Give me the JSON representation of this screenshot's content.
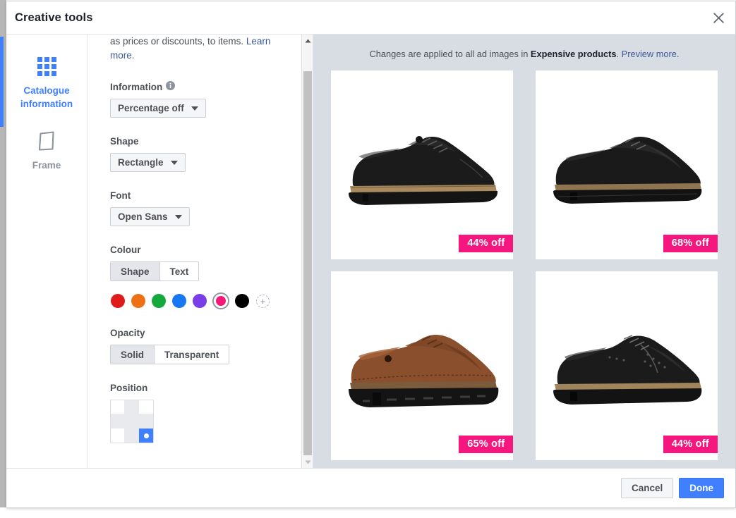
{
  "modal": {
    "title": "Creative tools",
    "close_icon": "close-icon"
  },
  "sidebar": {
    "items": [
      {
        "label": "Catalogue information",
        "icon": "grid-icon",
        "active": true
      },
      {
        "label": "Frame",
        "icon": "frame-icon",
        "active": false
      }
    ]
  },
  "form": {
    "intro_text_1": "as prices or discounts, to items. ",
    "intro_link": "Learn more",
    "intro_text_2": ".",
    "information": {
      "label": "Information",
      "info_icon": "info-icon",
      "value": "Percentage off"
    },
    "shape": {
      "label": "Shape",
      "value": "Rectangle"
    },
    "font": {
      "label": "Font",
      "value": "Open Sans"
    },
    "colour": {
      "label": "Colour",
      "tabs": [
        {
          "label": "Shape",
          "selected": true
        },
        {
          "label": "Text",
          "selected": false
        }
      ],
      "swatches": [
        {
          "name": "red",
          "hex": "#e01b1b",
          "selected": false
        },
        {
          "name": "orange",
          "hex": "#ed7014",
          "selected": false
        },
        {
          "name": "green",
          "hex": "#15a83c",
          "selected": false
        },
        {
          "name": "blue",
          "hex": "#1877f2",
          "selected": false
        },
        {
          "name": "purple",
          "hex": "#7a3ee8",
          "selected": false
        },
        {
          "name": "pink",
          "hex": "#f51878",
          "selected": true
        },
        {
          "name": "black",
          "hex": "#000000",
          "selected": false
        }
      ],
      "add_label": "+"
    },
    "opacity": {
      "label": "Opacity",
      "tabs": [
        {
          "label": "Solid",
          "selected": true
        },
        {
          "label": "Transparent",
          "selected": false
        }
      ]
    },
    "position": {
      "label": "Position",
      "selected_index": 8,
      "shaded_cells": [
        1,
        3,
        4,
        5,
        7
      ]
    }
  },
  "preview": {
    "notice_prefix": "Changes are applied to all ad images in ",
    "notice_catalogue": "Expensive products",
    "notice_middle": ". ",
    "notice_link": "Preview more.",
    "badge_color": "#f5167e",
    "ads": [
      {
        "product": "black-cap-toe-oxford",
        "badge": "44% off"
      },
      {
        "product": "black-moc-toe-derby",
        "badge": "68% off"
      },
      {
        "product": "brown-leather-derby",
        "badge": "65% off"
      },
      {
        "product": "black-wingtip-brogue",
        "badge": "44% off"
      }
    ]
  },
  "footer": {
    "cancel_label": "Cancel",
    "done_label": "Done"
  }
}
